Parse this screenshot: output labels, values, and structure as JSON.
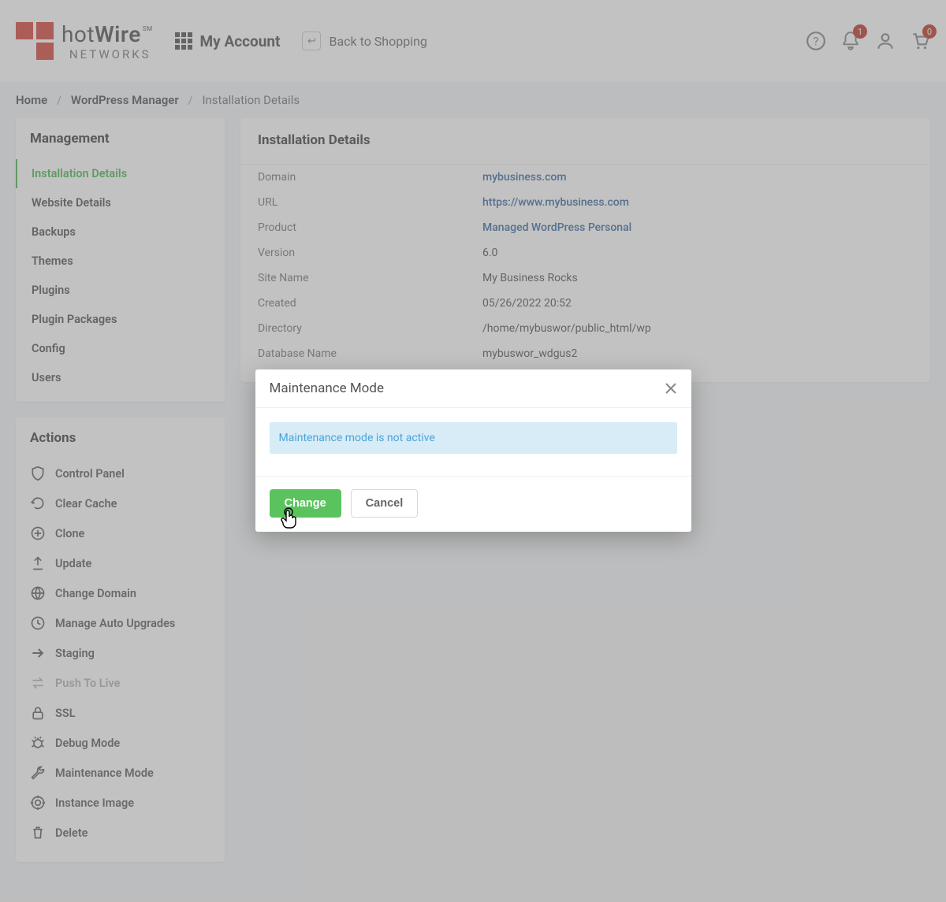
{
  "header": {
    "logo_top1": "hot",
    "logo_top2": "Wire",
    "logo_sm": "SM",
    "logo_bot": "NETWORKS",
    "account": "My Account",
    "back_shopping": "Back to Shopping",
    "notif_badge": "1",
    "cart_badge": "0"
  },
  "breadcrumb": {
    "home": "Home",
    "wp": "WordPress Manager",
    "current": "Installation Details"
  },
  "sidebar": {
    "management_title": "Management",
    "items": [
      {
        "label": "Installation Details",
        "active": true
      },
      {
        "label": "Website Details"
      },
      {
        "label": "Backups"
      },
      {
        "label": "Themes"
      },
      {
        "label": "Plugins"
      },
      {
        "label": "Plugin Packages"
      },
      {
        "label": "Config"
      },
      {
        "label": "Users"
      }
    ],
    "actions_title": "Actions",
    "actions": [
      {
        "label": "Control Panel",
        "icon": "shield"
      },
      {
        "label": "Clear Cache",
        "icon": "refresh"
      },
      {
        "label": "Clone",
        "icon": "plus-circle"
      },
      {
        "label": "Update",
        "icon": "upload"
      },
      {
        "label": "Change Domain",
        "icon": "globe"
      },
      {
        "label": "Manage Auto Upgrades",
        "icon": "history"
      },
      {
        "label": "Staging",
        "icon": "arrow-right"
      },
      {
        "label": "Push To Live",
        "icon": "swap",
        "muted": true
      },
      {
        "label": "SSL",
        "icon": "lock"
      },
      {
        "label": "Debug Mode",
        "icon": "bug"
      },
      {
        "label": "Maintenance Mode",
        "icon": "wrench"
      },
      {
        "label": "Instance Image",
        "icon": "target"
      },
      {
        "label": "Delete",
        "icon": "trash"
      }
    ]
  },
  "main": {
    "title": "Installation Details",
    "rows": [
      {
        "label": "Domain",
        "value": "mybusiness.com",
        "link": true
      },
      {
        "label": "URL",
        "value": "https://www.mybusiness.com",
        "link": true
      },
      {
        "label": "Product",
        "value": "Managed WordPress Personal",
        "link": true
      },
      {
        "label": "Version",
        "value": "6.0"
      },
      {
        "label": "Site Name",
        "value": "My Business Rocks"
      },
      {
        "label": "Created",
        "value": "05/26/2022 20:52"
      },
      {
        "label": "Directory",
        "value": "/home/mybuswor/public_html/wp"
      },
      {
        "label": "Database Name",
        "value": "mybuswor_wdgus2"
      }
    ]
  },
  "modal": {
    "title": "Maintenance Mode",
    "status": "Maintenance mode is not active",
    "change": "Change",
    "cancel": "Cancel"
  }
}
